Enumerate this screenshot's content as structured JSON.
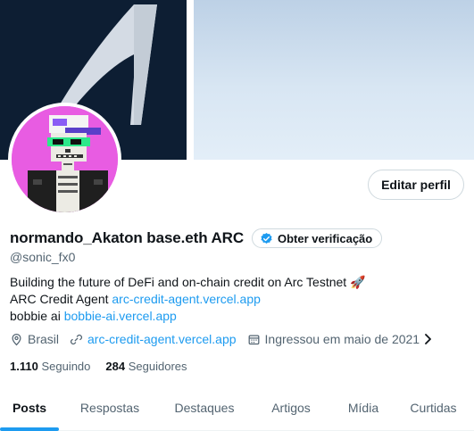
{
  "profile": {
    "display_name": "normando_Akaton base.eth ARC",
    "handle": "@sonic_fx0",
    "edit_label": "Editar perfil",
    "verify_label": "Obter verificação",
    "bio": {
      "line1": "Building the future of DeFi and on-chain credit on Arc Testnet",
      "line1_emoji": "🚀",
      "line2_prefix": "ARC Credit Agent ",
      "line2_link": "arc-credit-agent.vercel.app",
      "line3_prefix": "bobbie ai ",
      "line3_link": "bobbie-ai.vercel.app"
    },
    "meta": {
      "location": "Brasil",
      "website": "arc-credit-agent.vercel.app",
      "joined": "Ingressou em maio de 2021"
    },
    "stats": {
      "following_count": "1.110",
      "following_label": "Seguindo",
      "followers_count": "284",
      "followers_label": "Seguidores"
    }
  },
  "tabs": [
    {
      "label": "Posts",
      "active": true
    },
    {
      "label": "Respostas",
      "active": false
    },
    {
      "label": "Destaques",
      "active": false
    },
    {
      "label": "Artigos",
      "active": false
    },
    {
      "label": "Mídia",
      "active": false
    },
    {
      "label": "Curtidas",
      "active": false
    }
  ],
  "colors": {
    "accent": "#1d9bf0",
    "text_primary": "#0f1419",
    "text_secondary": "#536471",
    "avatar_bg": "#e85ce2"
  }
}
